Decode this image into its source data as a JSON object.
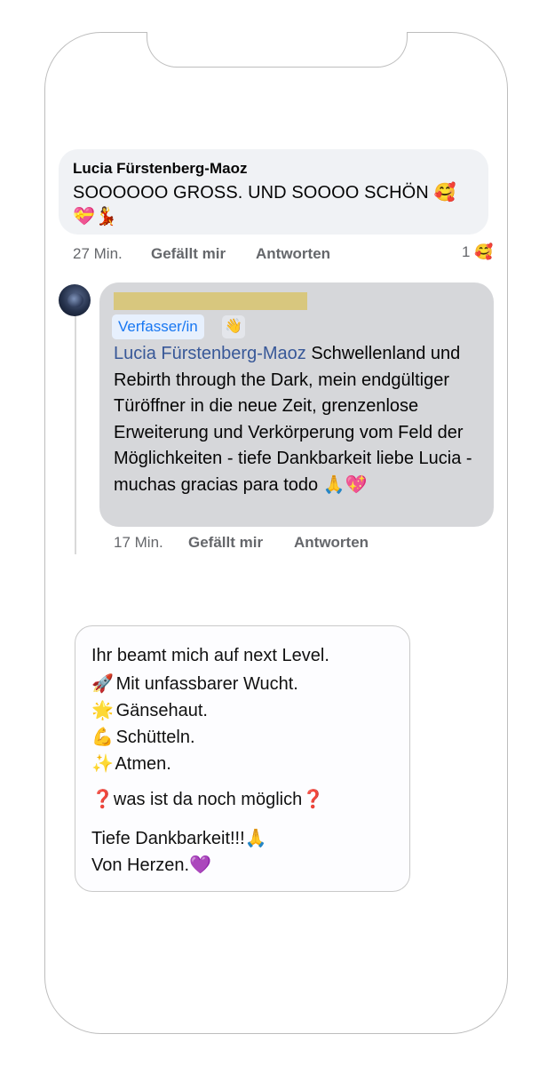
{
  "comment": {
    "author": "Lucia Fürstenberg-Maoz",
    "text": "SOOOOOO GROSS. UND SOOOO SCHÖN 🥰 💝💃",
    "time": "27 Min.",
    "like_label": "Gefällt mir",
    "reply_label": "Antworten",
    "reaction_count": "1",
    "reaction_emoji": "🥰"
  },
  "reply": {
    "author_badge": "Verfasser/in",
    "badge_icon": "wave-icon",
    "mention": "Lucia Fürstenberg-Maoz",
    "text": " Schwellenland und Rebirth through the Dark, mein endgültiger Türöffner in die neue Zeit, grenzenlose Erweiterung und Verkörperung vom Feld der Möglichkeiten - tiefe Dankbarkeit liebe Lucia - muchas gracias para todo 🙏💖",
    "time": "17 Min.",
    "like_label": "Gefällt mir",
    "reply_label": "Antworten"
  },
  "card": {
    "line1": "Ihr beamt mich auf next Level.",
    "line2_emoji": "🚀",
    "line2": "Mit unfassbarer Wucht.",
    "line3_emoji": "🌟",
    "line3": "Gänsehaut.",
    "line4_emoji": "💪",
    "line4": "Schütteln.",
    "line5_emoji": "✨",
    "line5": "Atmen.",
    "line6": "❓was ist da noch möglich❓",
    "line7": "Tiefe Dankbarkeit!!!🙏",
    "line8": "Von Herzen.💜"
  },
  "colors": {
    "badge_text": "#1877f2",
    "mention": "#385898",
    "redaction": "#d8c77e"
  }
}
